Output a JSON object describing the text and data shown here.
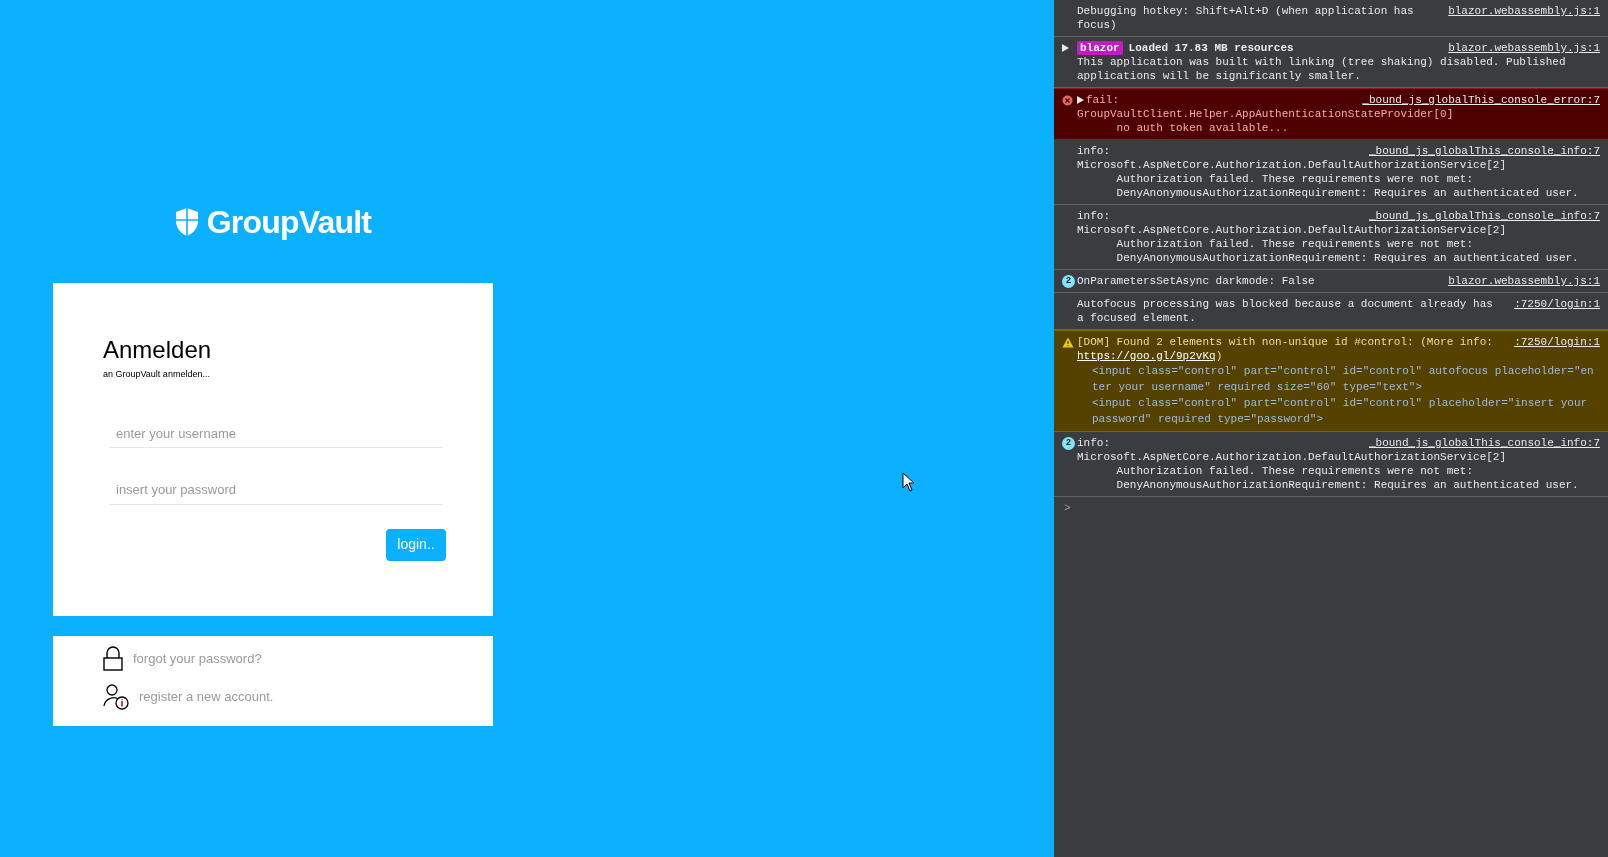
{
  "app": {
    "brand": "GroupVault",
    "login_card": {
      "title": "Anmelden",
      "subtitle": "an GroupVault anmelden...",
      "username": {
        "placeholder": "enter your username"
      },
      "password": {
        "placeholder": "insert your password"
      },
      "button": "login.."
    },
    "links": [
      {
        "kind": "lock",
        "label": "forgot your password?"
      },
      {
        "kind": "user-info",
        "label": "register a new account."
      }
    ]
  },
  "console": {
    "messages": [
      {
        "kind": "log",
        "head": "Debugging hotkey: Shift+Alt+D (when application has focus)",
        "source": "blazor.webassembly.js:1"
      },
      {
        "kind": "log",
        "expandable": true,
        "tag": "blazor",
        "head": "Loaded 17.83 MB resources",
        "source": "blazor.webassembly.js:1",
        "body": [
          "This application was built with linking (tree shaking) disabled. Published applications will be significantly smaller."
        ]
      },
      {
        "kind": "error",
        "expandable": true,
        "head": "fail:",
        "source": "_bound_js_globalThis_console_error:7",
        "body": [
          "GroupVaultClient.Helper.AppAuthenticationStateProvider[0]",
          "      no auth token available..."
        ]
      },
      {
        "kind": "log",
        "head": "info:",
        "source": "_bound_js_globalThis_console_info:7",
        "body": [
          "Microsoft.AspNetCore.Authorization.DefaultAuthorizationService[2]",
          "      Authorization failed. These requirements were not met:",
          "      DenyAnonymousAuthorizationRequirement: Requires an authenticated user."
        ]
      },
      {
        "kind": "log",
        "head": "info:",
        "source": "_bound_js_globalThis_console_info:7",
        "body": [
          "Microsoft.AspNetCore.Authorization.DefaultAuthorizationService[2]",
          "      Authorization failed. These requirements were not met:",
          "      DenyAnonymousAuthorizationRequirement: Requires an authenticated user."
        ]
      },
      {
        "kind": "log",
        "count": "2",
        "head": "OnParametersSetAsync darkmode: False",
        "source": "blazor.webassembly.js:1"
      },
      {
        "kind": "log",
        "head": "Autofocus processing was blocked because a document already has a focused element.",
        "source": ":7250/login:1"
      },
      {
        "kind": "warning",
        "head": "[DOM] Found 2 elements with non-unique id #control: (More info:",
        "link": "https://goo.gl/9p2vKq",
        "head_end": ")",
        "source": ":7250/login:1",
        "body": [
          "<input class=\"control\" part=\"control\" id=\"control\" autofocus placeholder=\"enter your username\" required size=\"60\" type=\"text\">",
          "<input class=\"control\" part=\"control\" id=\"control\" placeholder=\"insert your password\" required type=\"password\">"
        ]
      },
      {
        "kind": "log",
        "count": "2",
        "head": "info:",
        "source": "_bound_js_globalThis_console_info:7",
        "body": [
          "Microsoft.AspNetCore.Authorization.DefaultAuthorizationService[2]",
          "      Authorization failed. These requirements were not met:",
          "      DenyAnonymousAuthorizationRequirement: Requires an authenticated user."
        ]
      }
    ],
    "prompt": ">"
  }
}
